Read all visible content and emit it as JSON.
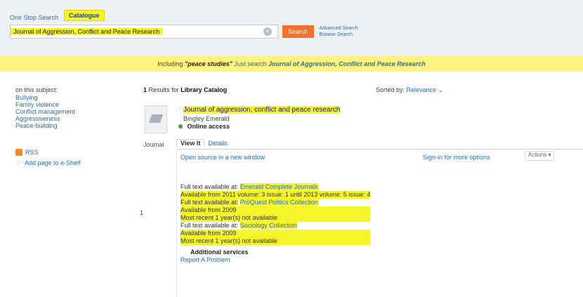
{
  "search": {
    "tabs": [
      {
        "label": "One Stop Search",
        "active": false
      },
      {
        "label": "Catalogue",
        "active": true
      }
    ],
    "query": "Journal of Aggression, Conflict and Peace Research",
    "clear_icon": "clear-icon",
    "button_label": "Search",
    "advanced": "Advanced Search",
    "browse": "Browse Search"
  },
  "banner": {
    "prefix": "Including",
    "term": "\"peace studies\"",
    "just_search": "Just search",
    "title": "Journal of Aggression, Conflict and Peace Research"
  },
  "sidebar": {
    "heading": "on this subject:",
    "items": [
      "Bullying",
      "Family violence",
      "Conflict management",
      "Aggressiveness",
      "Peace-building"
    ],
    "rss": "RSS",
    "add_shelf": "Add page to e-Shelf"
  },
  "results": {
    "count": "1",
    "count_label": "Results",
    "for_label": "for",
    "catalog": "Library Catalog",
    "sorted_label": "Sorted by:",
    "sorted_value": "Relevance"
  },
  "record": {
    "number": "1",
    "doc_type": "Journal",
    "title": "Journal of aggression, conflict and peace research",
    "author": "Bingley Emerald",
    "availability": "Online access",
    "tabs": [
      "View It",
      "Details"
    ],
    "open_source": "Open source in a new window",
    "signin": "Sign-in for more options",
    "actions": "Actions",
    "holdings": [
      {
        "label": "Full text available at:",
        "value": "Emerald Complete Journals"
      },
      {
        "label": "Available from 2011 volume: 3 issue: 1 until 2013 volume: 5 issue: 4",
        "value": ""
      },
      {
        "label": "Full text available at:",
        "value": "ProQuest Politics Collection"
      },
      {
        "label": "Available from 2009",
        "value": ""
      },
      {
        "label": "Most recent 1 year(s) not available",
        "value": ""
      },
      {
        "label": "Full text available at:",
        "value": "Sociology Collection"
      },
      {
        "label": "Available from 2009",
        "value": ""
      },
      {
        "label": "Most recent 1 year(s) not available",
        "value": ""
      }
    ],
    "additional_services": "Additional services",
    "report_problem": "Report A Problem"
  },
  "colors": {
    "highlight": "#f6f52a",
    "search_button": "#f1722e",
    "link": "#2a6db5",
    "banner": "#fbf37e"
  }
}
